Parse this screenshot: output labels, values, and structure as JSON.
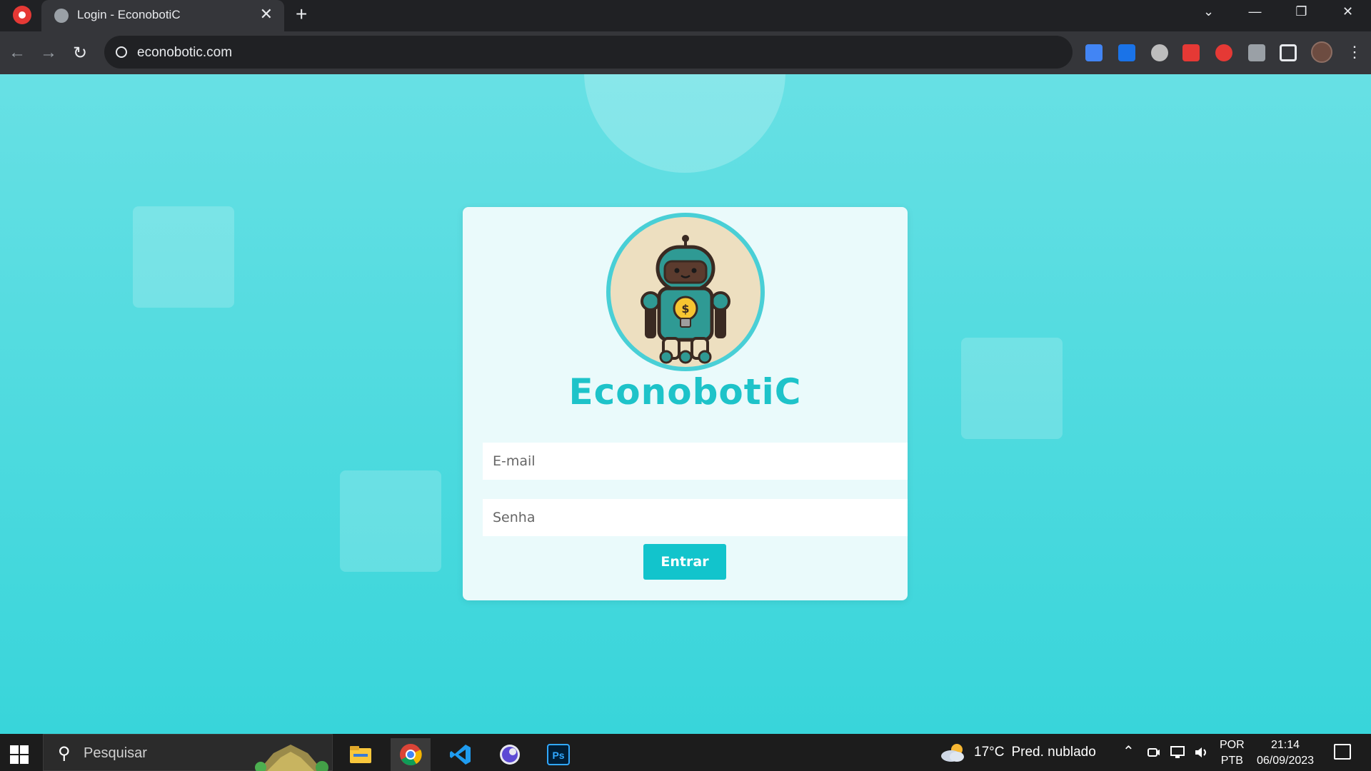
{
  "browser": {
    "tab_title": "Login - EconobotiC",
    "tab_close_glyph": "✕",
    "new_tab_glyph": "+",
    "url": "econobotic.com",
    "window_controls": {
      "chevron": "⌄",
      "minimize": "—",
      "restore": "❐",
      "close": "✕"
    },
    "nav": {
      "back": "←",
      "forward": "→",
      "reload": "↻"
    },
    "extension_icons": [
      "translate-icon",
      "fast-forward-icon",
      "mask-icon",
      "youtube-icon",
      "record-icon",
      "puzzle-icon",
      "side-panel-icon"
    ],
    "menu_glyph": "⋮"
  },
  "login": {
    "brand": "EconobotiC",
    "email_placeholder": "E-mail",
    "password_placeholder": "Senha",
    "submit_label": "Entrar"
  },
  "taskbar": {
    "search_placeholder": "Pesquisar",
    "search_glyph": "⚲",
    "pinned": [
      "file-explorer-icon",
      "chrome-icon",
      "vscode-icon",
      "obs-icon",
      "photoshop-icon"
    ],
    "photoshop_label": "Ps",
    "weather_temp": "17°C",
    "weather_text": "Pred. nublado",
    "lang_line1": "POR",
    "lang_line2": "PTB",
    "time": "21:14",
    "date": "06/09/2023"
  },
  "colors": {
    "accent": "#12c4cc",
    "brand_text": "#1ec3c9",
    "page_bg_top": "#67e0e4",
    "page_bg_bottom": "#38d5da"
  }
}
